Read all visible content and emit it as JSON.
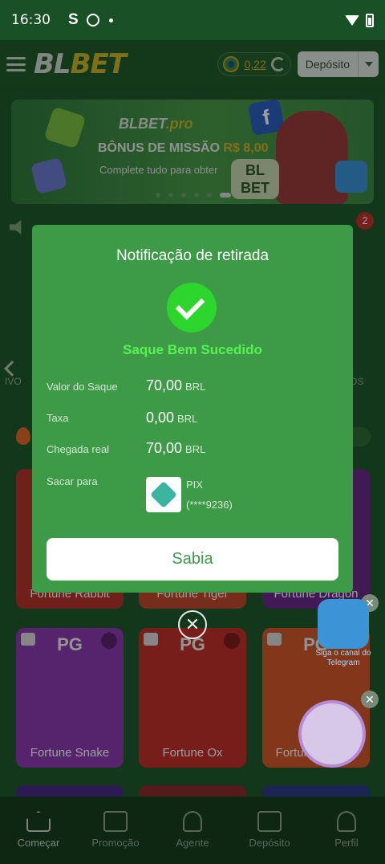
{
  "status_bar": {
    "time": "16:30",
    "s_label": "S"
  },
  "header": {
    "logo_part1": "BL",
    "logo_part2": "BET",
    "balance": "0,22",
    "deposit_label": "Depósito"
  },
  "banner": {
    "brand": "BLBET",
    "brand_suffix": ".pro",
    "bonus_title": "BÔNUS DE MISSÃO",
    "bonus_amount": "R$ 8,00",
    "subtitle": "Complete tudo para obter",
    "badge_text": "BL BET",
    "facebook": "f"
  },
  "notification_count": "2",
  "side_labels": {
    "left": "IVO",
    "right": "OS"
  },
  "games": [
    {
      "name": "Fortune Rabbit",
      "bg": "#b5352c"
    },
    {
      "name": "Fortune Tiger",
      "bg": "#c04a2c"
    },
    {
      "name": "Fortune Dragon",
      "bg": "#6a2a8a"
    },
    {
      "name": "Fortune Snake",
      "bg": "#8a3ab0",
      "pg": "PG"
    },
    {
      "name": "Fortune Ox",
      "bg": "#c0302a",
      "pg": "PG"
    },
    {
      "name": "Fortune Mouse",
      "bg": "#d2582a",
      "pg": "PG"
    }
  ],
  "telegram_promo": "Siga o canal do Telegram",
  "bottom_nav": [
    {
      "label": "Começar",
      "active": true
    },
    {
      "label": "Promoção"
    },
    {
      "label": "Agente"
    },
    {
      "label": "Depósito"
    },
    {
      "label": "Perfil"
    }
  ],
  "modal": {
    "title": "Notificação de retirada",
    "status": "Saque Bem Sucedido",
    "rows": [
      {
        "label": "Valor do Saque",
        "value": "70,00",
        "unit": "BRL"
      },
      {
        "label": "Taxa",
        "value": "0,00",
        "unit": "BRL"
      },
      {
        "label": "Chegada real",
        "value": "70,00",
        "unit": "BRL"
      }
    ],
    "destination_label": "Sacar para",
    "method": "PIX",
    "account": "(****9236)",
    "button": "Sabia"
  },
  "colors": {
    "modal_bg": "#3d9a46",
    "success": "#2dd62d",
    "brand_gold": "#c9b62a"
  }
}
